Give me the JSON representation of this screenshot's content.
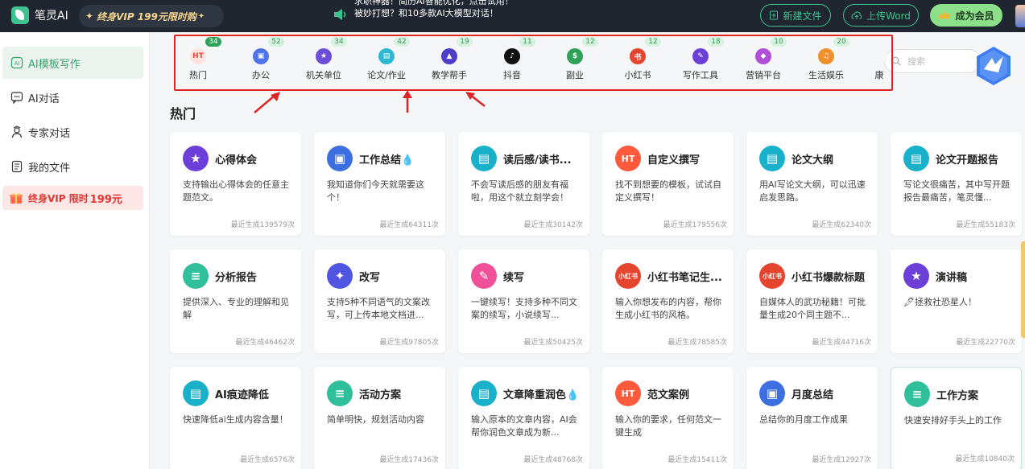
{
  "app": {
    "name": "笔灵AI"
  },
  "topbar": {
    "vip_promo": "终身VIP 199元限时购",
    "notice_line1": "求职神器！简历AI智能优化，点击试用！",
    "notice_line2": "被妙打想？和10多款AI大模型对话！",
    "new_file": "新建文件",
    "upload_word": "上传Word",
    "member": "成为会员"
  },
  "sidebar": {
    "items": [
      {
        "label": "AI模板写作",
        "icon": "ai-template-icon"
      },
      {
        "label": "AI对话",
        "icon": "chat-icon"
      },
      {
        "label": "专家对话",
        "icon": "expert-icon"
      },
      {
        "label": "我的文件",
        "icon": "file-icon"
      }
    ],
    "vip_label": "终身VIP 限时 ",
    "vip_price": "199元"
  },
  "categories": [
    {
      "label": "热门",
      "count": "34",
      "color": "#ffe3e0",
      "fg": "#ef4b32",
      "glyph": "HT"
    },
    {
      "label": "办公",
      "count": "52",
      "color": "#4f73e8",
      "fg": "#fff",
      "glyph": "▣"
    },
    {
      "label": "机关单位",
      "count": "34",
      "color": "#6c4fd8",
      "fg": "#fff",
      "glyph": "★"
    },
    {
      "label": "论文/作业",
      "count": "42",
      "color": "#2fb7d4",
      "fg": "#fff",
      "glyph": "▤"
    },
    {
      "label": "教学帮手",
      "count": "19",
      "color": "#4c3ec8",
      "fg": "#fff",
      "glyph": "▲"
    },
    {
      "label": "抖音",
      "count": "11",
      "color": "#111",
      "fg": "#fff",
      "glyph": "♪"
    },
    {
      "label": "副业",
      "count": "12",
      "color": "#2fa25a",
      "fg": "#fff",
      "glyph": "$"
    },
    {
      "label": "小红书",
      "count": "12",
      "color": "#e5452f",
      "fg": "#fff",
      "glyph": "书"
    },
    {
      "label": "写作工具",
      "count": "18",
      "color": "#6c3fd8",
      "fg": "#fff",
      "glyph": "✎"
    },
    {
      "label": "营销平台",
      "count": "10",
      "color": "#b04fd8",
      "fg": "#fff",
      "glyph": "◆"
    },
    {
      "label": "生活娱乐",
      "count": "20",
      "color": "#f0902a",
      "fg": "#fff",
      "glyph": "♫"
    },
    {
      "label": "康",
      "count": "",
      "color": "#f5f6f8",
      "fg": "#f5f6f8",
      "glyph": ""
    }
  ],
  "search": {
    "placeholder": "搜索"
  },
  "section": {
    "title": "热门"
  },
  "cards": [
    {
      "title": "心得体会",
      "desc": "支持输出心得体会的任意主题范文。",
      "count": "最近生成139579次",
      "icon": "star-icon",
      "color": "#6c3fd8",
      "glyph": "★"
    },
    {
      "title": "工作总结💧",
      "desc": "我知道你们今天就需要这个！",
      "count": "最近生成64311次",
      "icon": "briefcase-icon",
      "color": "#3d6fe0",
      "glyph": "▣"
    },
    {
      "title": "读后感/读书...",
      "desc": "不会写读后感的朋友有福啦，用这个就立刻学会！",
      "count": "最近生成30142次",
      "icon": "book-icon",
      "color": "#19b1c9",
      "glyph": "▤"
    },
    {
      "title": "自定义撰写",
      "desc": "找不到想要的模板，试试自定义撰写！",
      "count": "最近生成179556次",
      "icon": "hot-icon",
      "color": "#ff5a3c",
      "glyph": "HT"
    },
    {
      "title": "论文大纲",
      "desc": "用AI写论文大纲，可以迅速启发思路。",
      "count": "最近生成62340次",
      "icon": "book-icon",
      "color": "#19b1c9",
      "glyph": "▤"
    },
    {
      "title": "论文开题报告",
      "desc": "写论文很痛苦，其中写开题报告最痛苦，笔灵懂...",
      "count": "最近生成55183次",
      "icon": "book-icon",
      "color": "#19b1c9",
      "glyph": "▤"
    },
    {
      "title": "分析报告",
      "desc": "提供深入、专业的理解和见解",
      "count": "最近生成46462次",
      "icon": "document-icon",
      "color": "#2fbf9b",
      "glyph": "≡"
    },
    {
      "title": "改写",
      "desc": "支持5种不同语气的文案改写，可上传本地文档进...",
      "count": "最近生成97805次",
      "icon": "magic-icon",
      "color": "#4f55e0",
      "glyph": "✦"
    },
    {
      "title": "续写",
      "desc": "一键续写！支持多种不同文案的续写，小说续写...",
      "count": "最近生成50425次",
      "icon": "pen-icon",
      "color": "#f04f9a",
      "glyph": "✎"
    },
    {
      "title": "小红书笔记生...",
      "desc": "输入你想发布的内容，帮你生成小红书的风格。",
      "count": "最近生成78585次",
      "icon": "xiaohongshu-icon",
      "color": "#e5452f",
      "glyph": "小红书"
    },
    {
      "title": "小红书爆款标题",
      "desc": "自媒体人的武功秘籍！可批量生成20个同主题不...",
      "count": "最近生成44716次",
      "icon": "xiaohongshu-icon",
      "color": "#e5452f",
      "glyph": "小红书"
    },
    {
      "title": "演讲稿",
      "desc": "🖊拯救社恐星人！",
      "count": "最近生成22770次",
      "icon": "star-icon",
      "color": "#6c3fd8",
      "glyph": "★"
    },
    {
      "title": "AI痕迹降低",
      "desc": "快速降低ai生成内容含量！",
      "count": "最近生成6576次",
      "icon": "book-icon",
      "color": "#19b1c9",
      "glyph": "▤"
    },
    {
      "title": "活动方案",
      "desc": "简单明快，规划活动内容",
      "count": "最近生成17436次",
      "icon": "document-icon",
      "color": "#2fbf9b",
      "glyph": "≡"
    },
    {
      "title": "文章降重润色💧",
      "desc": "输入原本的文章内容，AI会帮你润色文章成为新...",
      "count": "最近生成48768次",
      "icon": "book-icon",
      "color": "#19b1c9",
      "glyph": "▤"
    },
    {
      "title": "范文案例",
      "desc": "输入你的要求，任何范文一键生成",
      "count": "最近生成15411次",
      "icon": "hot-icon",
      "color": "#ff5a3c",
      "glyph": "HT"
    },
    {
      "title": "月度总结",
      "desc": "总结你的月度工作成果",
      "count": "最近生成12927次",
      "icon": "briefcase-icon",
      "color": "#3d6fe0",
      "glyph": "▣"
    },
    {
      "title": "工作方案",
      "desc": "快速安排好手头上的工作",
      "count": "最近生成10840次",
      "icon": "document-icon",
      "color": "#2fbf9b",
      "glyph": "≡"
    }
  ]
}
